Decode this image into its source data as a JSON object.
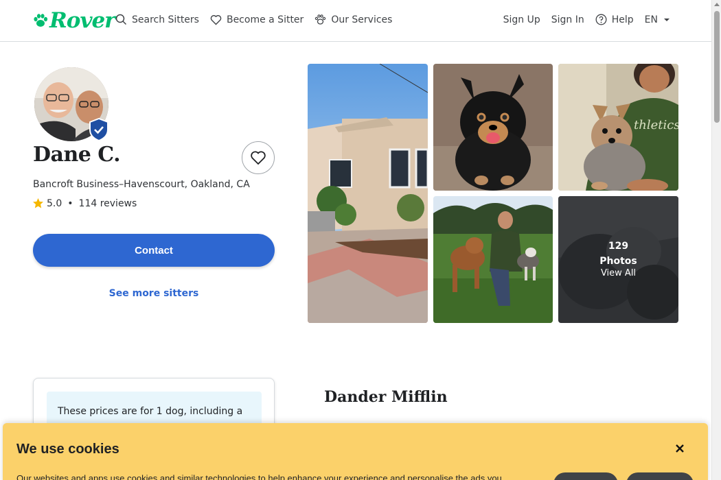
{
  "header": {
    "logo_text": "Rover",
    "nav_left": [
      {
        "label": "Search Sitters",
        "icon": "search-icon"
      },
      {
        "label": "Become a Sitter",
        "icon": "heart-icon"
      },
      {
        "label": "Our Services",
        "icon": "paw-icon"
      }
    ],
    "nav_right": {
      "sign_up": "Sign Up",
      "sign_in": "Sign In",
      "help": "Help",
      "language": "EN"
    }
  },
  "profile": {
    "name": "Dane C.",
    "location": "Bancroft Business–Havenscourt, Oakland, CA",
    "rating": "5.0",
    "reviews": "114 reviews",
    "contact_label": "Contact",
    "see_more_label": "See more sitters"
  },
  "photos": {
    "count": "129",
    "label": "Photos",
    "view_all": "View All"
  },
  "pricing": {
    "note": "These prices are for 1 dog, including a"
  },
  "business_name": "Dander Mifflin",
  "cookie_banner": {
    "title": "We use cookies",
    "text": "Our websites and apps use cookies and similar technologies to help enhance your experience and personalise the ads you"
  },
  "colors": {
    "brand_green": "#00bd70",
    "primary_blue": "#2e67d1",
    "cookie_yellow": "#fbd16a",
    "verified_badge": "#1f4fa3"
  }
}
